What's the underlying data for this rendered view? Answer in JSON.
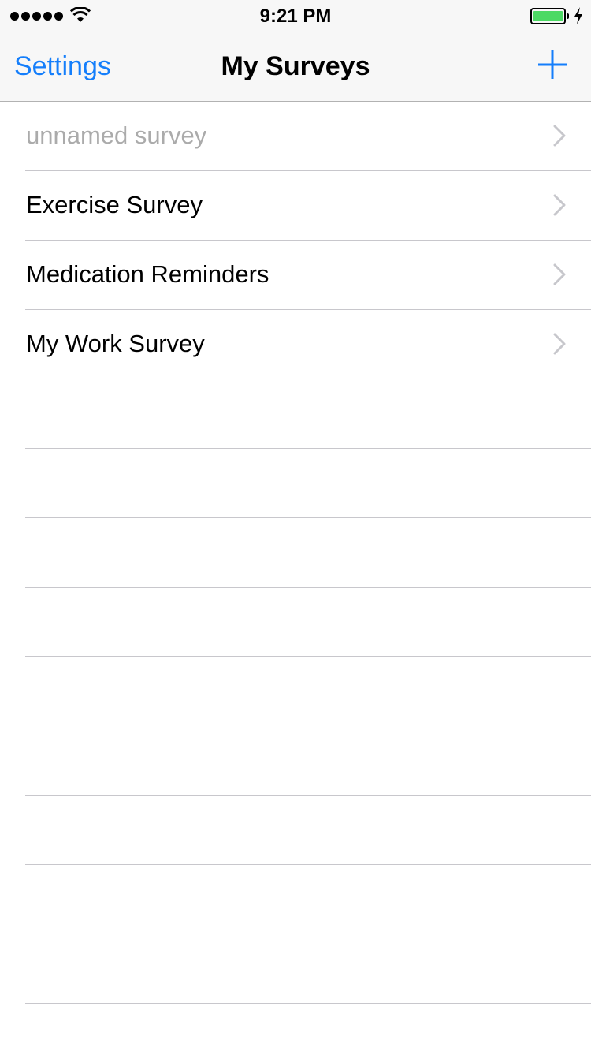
{
  "status_bar": {
    "time": "9:21 PM",
    "battery_level": 1.0,
    "battery_color": "#4cd964",
    "icons": [
      "signal-dots",
      "wifi-icon",
      "battery-icon",
      "charging-bolt-icon"
    ]
  },
  "nav": {
    "left_button": "Settings",
    "title": "My Surveys",
    "right_icon": "plus-icon",
    "accent_color": "#147efb"
  },
  "surveys": [
    {
      "label": "unnamed survey",
      "placeholder": true
    },
    {
      "label": "Exercise Survey",
      "placeholder": false
    },
    {
      "label": "Medication Reminders",
      "placeholder": false
    },
    {
      "label": "My Work Survey",
      "placeholder": false
    }
  ]
}
